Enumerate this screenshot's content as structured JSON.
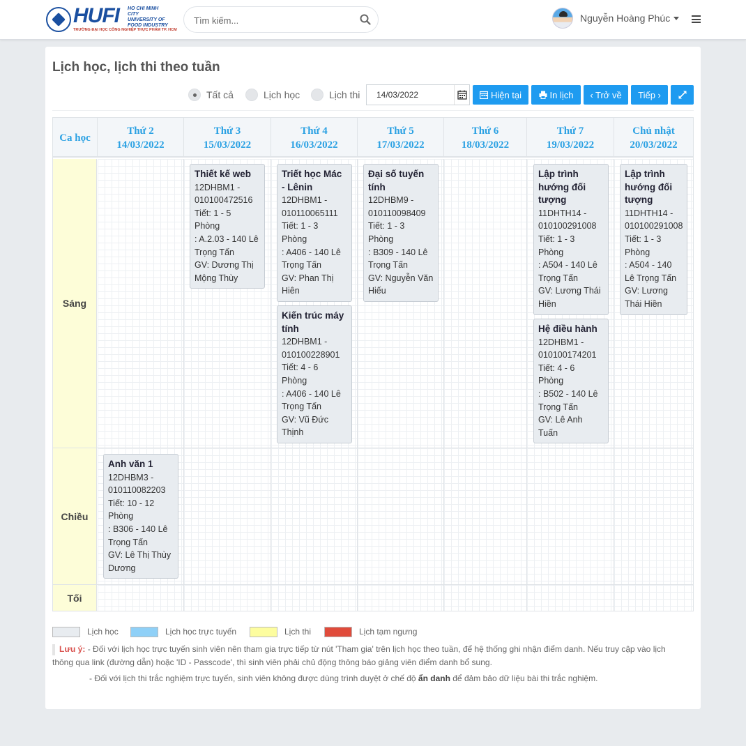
{
  "header": {
    "logo_big": "HUFI",
    "logo_small_line1": "HO CHI MINH CITY",
    "logo_small_line2": "UNIVERSITY OF",
    "logo_small_line3": "FOOD INDUSTRY",
    "logo_sub": "TRƯỜNG ĐẠI HỌC CÔNG NGHIỆP THỰC PHẨM TP. HCM",
    "search_placeholder": "Tìm kiếm...",
    "user_name": "Nguyễn Hoàng Phúc"
  },
  "page": {
    "title": "Lịch học, lịch thi theo tuần"
  },
  "filters": {
    "options": [
      "Tất cả",
      "Lịch học",
      "Lịch thi"
    ],
    "selected": "Tất cả",
    "date_value": "14/03/2022"
  },
  "buttons": {
    "current": "Hiện tại",
    "print": "In lịch",
    "back": "‹ Trở về",
    "next": "Tiếp ›"
  },
  "schedule": {
    "shift_header": "Ca học",
    "days": [
      {
        "name": "Thứ 2",
        "date": "14/03/2022"
      },
      {
        "name": "Thứ 3",
        "date": "15/03/2022"
      },
      {
        "name": "Thứ 4",
        "date": "16/03/2022"
      },
      {
        "name": "Thứ 5",
        "date": "17/03/2022"
      },
      {
        "name": "Thứ 6",
        "date": "18/03/2022"
      },
      {
        "name": "Thứ 7",
        "date": "19/03/2022"
      },
      {
        "name": "Chủ nhật",
        "date": "20/03/2022"
      }
    ],
    "shifts": [
      "Sáng",
      "Chiều",
      "Tối"
    ],
    "sessions": [
      {
        "shift": "Sáng",
        "day": "Thứ 3",
        "name": "Thiết kế web",
        "class": "12DHBM1 - 010100472516",
        "periods": "Tiết: 1 - 5",
        "room_label": "Phòng",
        "room": ": A.2.03 - 140 Lê Trọng Tấn",
        "teacher": "GV: Dương Thị Mộng Thùy"
      },
      {
        "shift": "Sáng",
        "day": "Thứ 4",
        "name": "Triết học Mác - Lênin",
        "class": "12DHBM1 - 010110065111",
        "periods": "Tiết: 1 - 3",
        "room_label": "Phòng",
        "room": ": A406 - 140 Lê Trọng Tấn",
        "teacher": "GV: Phan Thị Hiên"
      },
      {
        "shift": "Sáng",
        "day": "Thứ 4",
        "name": "Kiến trúc máy tính",
        "class": "12DHBM1 - 010100228901",
        "periods": "Tiết: 4 - 6",
        "room_label": "Phòng",
        "room": ": A406 - 140 Lê Trọng Tấn",
        "teacher": "GV: Vũ Đức Thịnh"
      },
      {
        "shift": "Sáng",
        "day": "Thứ 5",
        "name": "Đại số tuyến tính",
        "class": "12DHBM9 - 010110098409",
        "periods": "Tiết: 1 - 3",
        "room_label": "Phòng",
        "room": ": B309 - 140 Lê Trọng Tấn",
        "teacher": "GV: Nguyễn Văn Hiếu"
      },
      {
        "shift": "Sáng",
        "day": "Thứ 7",
        "name": "Lập trình hướng đối tượng",
        "class": "11DHTH14 - 010100291008",
        "periods": "Tiết: 1 - 3",
        "room_label": "Phòng",
        "room": ": A504 - 140 Lê Trọng Tấn",
        "teacher": "GV: Lương Thái Hiền"
      },
      {
        "shift": "Sáng",
        "day": "Thứ 7",
        "name": "Hệ điều hành",
        "class": "12DHBM1 - 010100174201",
        "periods": "Tiết: 4 - 6",
        "room_label": "Phòng",
        "room": ": B502 - 140 Lê Trọng Tấn",
        "teacher": "GV: Lê Anh Tuấn"
      },
      {
        "shift": "Sáng",
        "day": "Chủ nhật",
        "name": "Lập trình hướng đối tượng",
        "class": "11DHTH14 - 010100291008",
        "periods": "Tiết: 1 - 3",
        "room_label": "Phòng",
        "room": ": A504 - 140 Lê Trọng Tấn",
        "teacher": "GV: Lương Thái Hiền"
      },
      {
        "shift": "Chiều",
        "day": "Thứ 2",
        "name": "Anh văn 1",
        "class": "12DHBM3 - 010110082203",
        "periods": "Tiết: 10 - 12",
        "room_label": "Phòng",
        "room": ": B306 - 140 Lê Trọng Tấn",
        "teacher": "GV: Lê Thị Thùy Dương"
      }
    ]
  },
  "legend": [
    {
      "label": "Lịch học",
      "color": "#e8ecf0"
    },
    {
      "label": "Lịch học trực tuyến",
      "color": "#8fd0f7"
    },
    {
      "label": "Lịch thi",
      "color": "#fdfd9f"
    },
    {
      "label": "Lịch tạm ngưng",
      "color": "#e04b3b"
    }
  ],
  "notes": {
    "warn_label": "Lưu ý:",
    "line1": " - Đối với lịch học trực tuyến sinh viên nên tham gia trực tiếp từ nút 'Tham gia' trên lịch học theo tuần, để hệ thống ghi nhận điểm danh. Nếu truy cập vào lịch thông qua link (đường dẫn) hoặc 'ID - Passcode', thì sinh viên phải chủ động thông báo giảng viên điểm danh bổ sung.",
    "line2_pre": "- Đối với lịch thi trắc nghiệm trực tuyến, sinh viên không được dùng trình duyệt ở chế độ ",
    "line2_bold": "ẩn danh",
    "line2_post": " để đảm bảo dữ liệu bài thi trắc nghiệm."
  }
}
